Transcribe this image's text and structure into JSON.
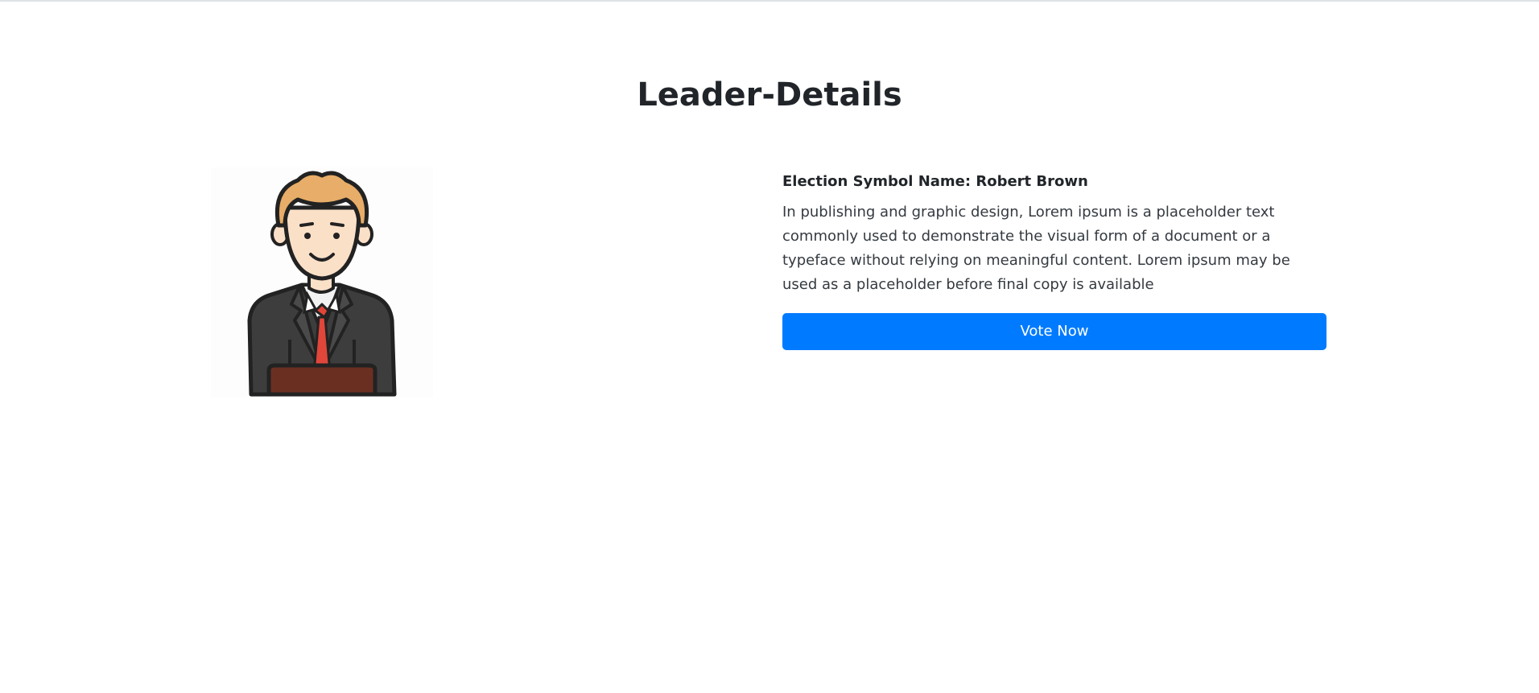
{
  "page": {
    "title": "Leader-Details"
  },
  "leader": {
    "image_icon": "leader-at-podium-icon",
    "symbol_line": "Election Symbol Name: Robert Brown",
    "description": "In publishing and graphic design, Lorem ipsum is a placeholder text commonly used to demonstrate the visual form of a document or a typeface without relying on meaningful content. Lorem ipsum may be used as a placeholder before final copy is available",
    "vote_label": "Vote Now"
  },
  "colors": {
    "primary": "#007bff",
    "text": "#212529",
    "hair": "#e8ad68",
    "skin": "#fbe0c8",
    "suit": "#3d3d3d",
    "tie": "#e0463a",
    "podium": "#6b2f22"
  }
}
